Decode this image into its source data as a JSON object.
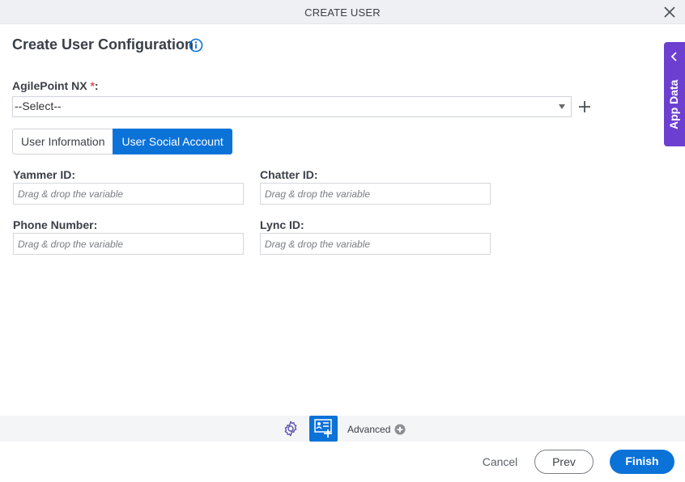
{
  "window": {
    "title": "CREATE USER",
    "close_icon": "close-icon"
  },
  "header": {
    "title": "Create User Configuration",
    "info_icon": "info-icon"
  },
  "agilepoint": {
    "label": "AgilePoint NX",
    "required_mark": "*",
    "label_suffix": ":",
    "selected": "--Select--",
    "add_icon": "plus-icon"
  },
  "tabs": [
    {
      "label": "User Information",
      "active": false
    },
    {
      "label": "User Social Account",
      "active": true
    }
  ],
  "fields": {
    "yammer": {
      "label": "Yammer ID:",
      "placeholder": "Drag & drop the variable",
      "value": ""
    },
    "chatter": {
      "label": "Chatter ID:",
      "placeholder": "Drag & drop the variable",
      "value": ""
    },
    "phone": {
      "label": "Phone Number:",
      "placeholder": "Drag & drop the variable",
      "value": ""
    },
    "lync": {
      "label": "Lync ID:",
      "placeholder": "Drag & drop the variable",
      "value": ""
    }
  },
  "side_panel": {
    "label": "App Data",
    "icon": "chevron-left-icon",
    "color": "#6c3fd1"
  },
  "toolbar": {
    "settings_icon": "gear-icon",
    "form_icon": "contact-card-add-icon",
    "advanced_label": "Advanced",
    "advanced_icon": "plus-circle-icon"
  },
  "footer": {
    "cancel_label": "Cancel",
    "prev_label": "Prev",
    "finish_label": "Finish"
  },
  "colors": {
    "primary": "#0b72d8",
    "accent_purple": "#6c3fd1",
    "required": "#d9534f"
  }
}
